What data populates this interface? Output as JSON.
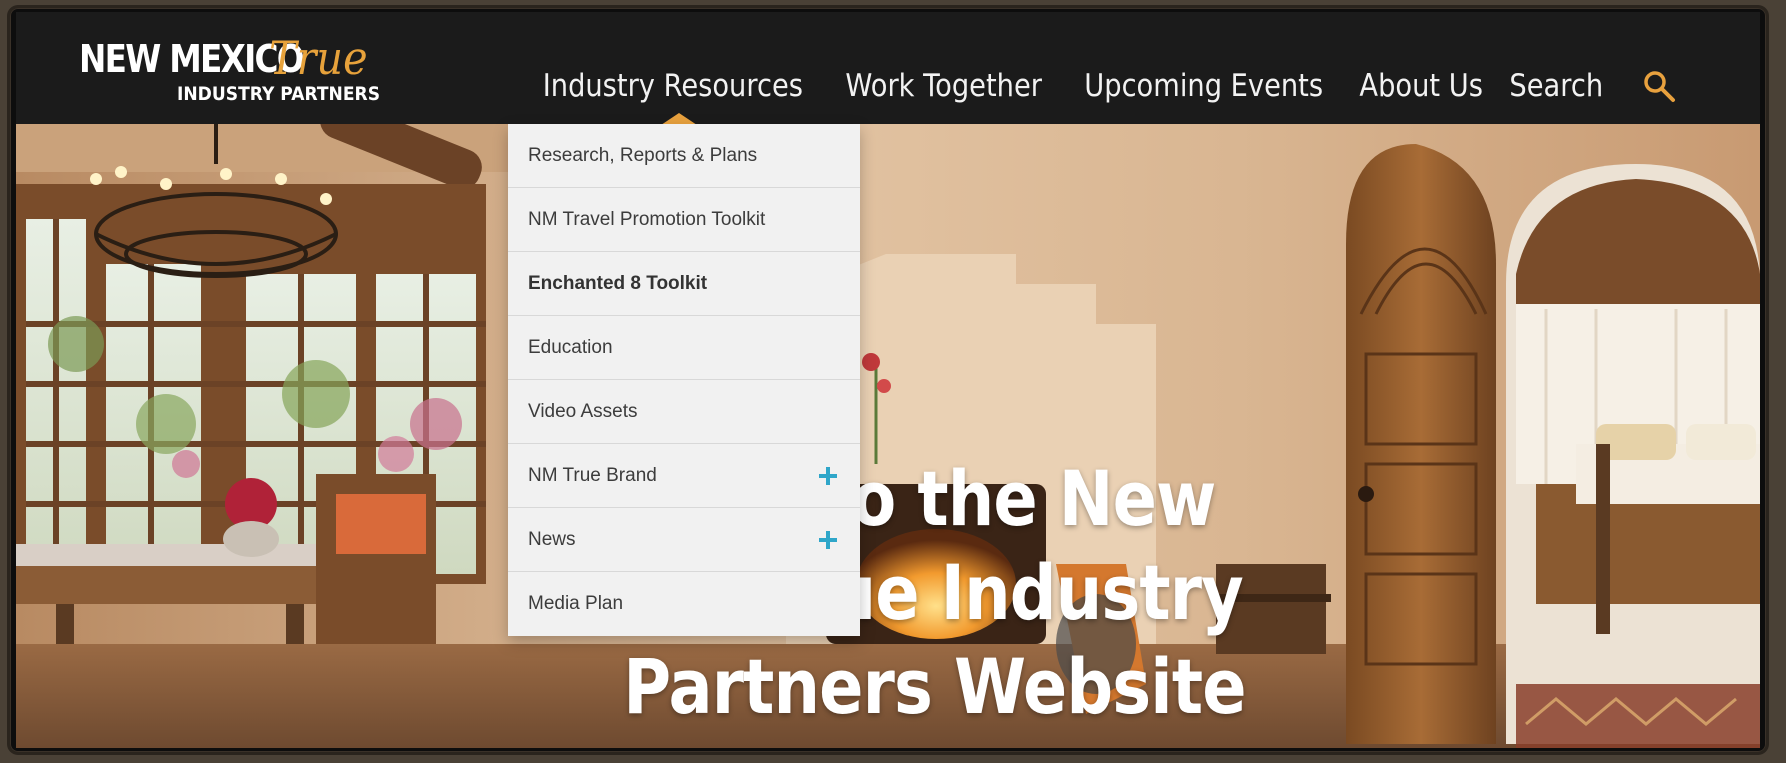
{
  "logo": {
    "line1": "NEW MEXICO",
    "accent": "True",
    "line2": "INDUSTRY PARTNERS"
  },
  "nav": {
    "items": [
      {
        "label": "Industry Resources"
      },
      {
        "label": "Work Together"
      },
      {
        "label": "Upcoming Events"
      },
      {
        "label": "About Us"
      },
      {
        "label": "Search"
      }
    ],
    "search_icon": "magnifier-icon"
  },
  "dropdown": {
    "items": [
      {
        "label": "Research, Reports & Plans"
      },
      {
        "label": "NM Travel Promotion Toolkit"
      },
      {
        "label": "Enchanted 8 Toolkit"
      },
      {
        "label": "Education"
      },
      {
        "label": "Video Assets"
      },
      {
        "label": "NM True Brand",
        "expand_icon": "plus-icon"
      },
      {
        "label": "News",
        "expand_icon": "plus-icon"
      },
      {
        "label": "Media Plan"
      }
    ]
  },
  "hero": {
    "title_line1": "to the New",
    "title_line2": "ue Industry",
    "title_line3": "Partners Website"
  },
  "colors": {
    "header_bg": "#1b1b1b",
    "accent": "#e8a13e",
    "plus": "#2fa6c9",
    "dropdown_bg": "#f1f1f1"
  }
}
